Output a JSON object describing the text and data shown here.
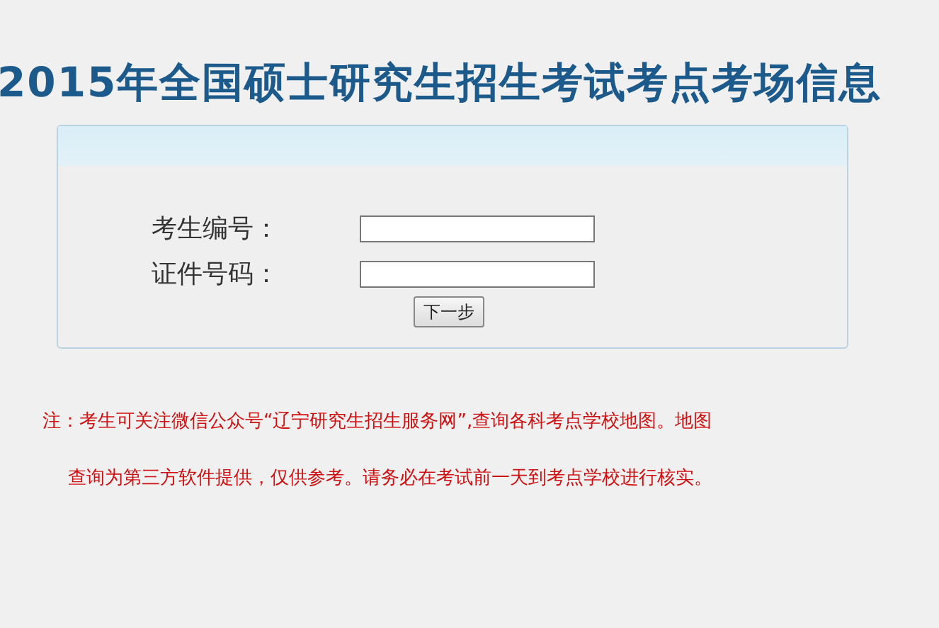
{
  "title": "2015年全国硕士研究生招生考试考点考场信息",
  "form": {
    "fields": [
      {
        "label": "考生编号："
      },
      {
        "label": "证件号码："
      }
    ],
    "button": "下一步"
  },
  "notes": [
    "注：考生可关注微信公众号“辽宁研究生招生服务网”,查询各科考点学校地图。地图",
    "查询为第三方软件提供，仅供参考。请务必在考试前一天到考点学校进行核实。"
  ]
}
